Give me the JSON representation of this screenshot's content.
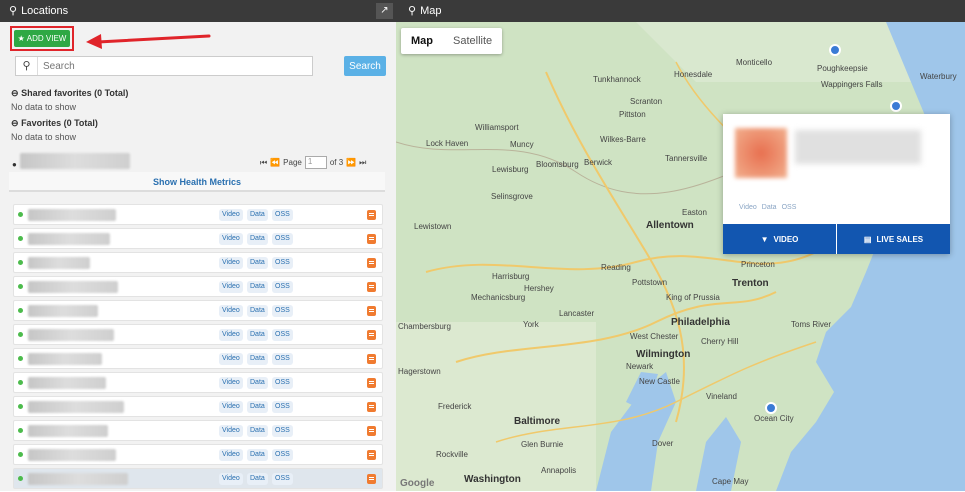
{
  "topbar": {
    "locations_title": "Locations",
    "map_title": "Map",
    "pin_icon": "map-pin-icon",
    "expand_glyph": "↗"
  },
  "left": {
    "add_view_label": "ADD VIEW",
    "search": {
      "placeholder": "Search",
      "button_label": "Search"
    },
    "shared_favorites_title": "Shared favorites (0 Total)",
    "shared_favorites_note": "No data to show",
    "favorites_title": "Favorites (0 Total)",
    "favorites_note": "No data to show",
    "pager": {
      "page_label": "Page",
      "page_value": "1",
      "of_label": "of 3"
    },
    "health_label": "Show Health Metrics",
    "rows": [
      {
        "video": "Video",
        "data": "Data",
        "oss": "OSS"
      },
      {
        "video": "Video",
        "data": "Data",
        "oss": "OSS"
      },
      {
        "video": "Video",
        "data": "Data",
        "oss": "OSS"
      },
      {
        "video": "Video",
        "data": "Data",
        "oss": "OSS"
      },
      {
        "video": "Video",
        "data": "Data",
        "oss": "OSS"
      },
      {
        "video": "Video",
        "data": "Data",
        "oss": "OSS"
      },
      {
        "video": "Video",
        "data": "Data",
        "oss": "OSS"
      },
      {
        "video": "Video",
        "data": "Data",
        "oss": "OSS"
      },
      {
        "video": "Video",
        "data": "Data",
        "oss": "OSS"
      },
      {
        "video": "Video",
        "data": "Data",
        "oss": "OSS"
      },
      {
        "video": "Video",
        "data": "Data",
        "oss": "OSS"
      },
      {
        "video": "Video",
        "data": "Data",
        "oss": "OSS"
      }
    ]
  },
  "map": {
    "map_type": [
      "Map",
      "Satellite"
    ],
    "popup": {
      "chips": [
        "Video",
        "Data",
        "OSS"
      ],
      "video_label": "VIDEO",
      "live_sales_label": "LIVE SALES"
    },
    "labels": {
      "allentown": "Allentown",
      "trenton": "Trenton",
      "philadelphia": "Philadelphia",
      "baltimore": "Baltimore",
      "washington": "Washington",
      "wilmington": "Wilmington",
      "harrisburg": "Harrisburg",
      "reading": "Reading",
      "lancaster": "Lancaster",
      "york": "York",
      "hershey": "Hershey",
      "scranton": "Scranton",
      "wilkes_barre": "Wilkes-Barre",
      "williamsport": "Williamsport",
      "lock_haven": "Lock Haven",
      "monticello": "Monticello",
      "poughkeepsie": "Poughkeepsie",
      "princeton": "Princeton",
      "toms_river": "Toms River",
      "vineland": "Vineland",
      "dover": "Dover",
      "annapolis": "Annapolis",
      "frederick": "Frederick",
      "cape_may": "Cape May",
      "chambersburg": "Chambersburg",
      "mechanicsburg": "Mechanicsburg",
      "pottstown": "Pottstown",
      "easton": "Easton",
      "bloomsburg": "Bloomsburg",
      "tannersville": "Tannersville",
      "lewisburg": "Lewisburg",
      "selinsgrove": "Selinsgrove",
      "lewistown": "Lewistown",
      "hagerstown": "Hagerstown",
      "glen_burnie": "Glen Burnie",
      "rockville": "Rockville",
      "newark": "Newark",
      "new_castle": "New Castle",
      "west_chester": "West Chester",
      "cherry_hill": "Cherry Hill",
      "king_of_prussia": "King of Prussia",
      "honesdale": "Honesdale",
      "tunkhannock": "Tunkhannock",
      "pittston": "Pittston",
      "muncy": "Muncy",
      "berwick": "Berwick",
      "wappingers": "Wappingers Falls",
      "waterbury": "Waterbury",
      "ocean_city": "Ocean City",
      "google": "Google"
    }
  }
}
